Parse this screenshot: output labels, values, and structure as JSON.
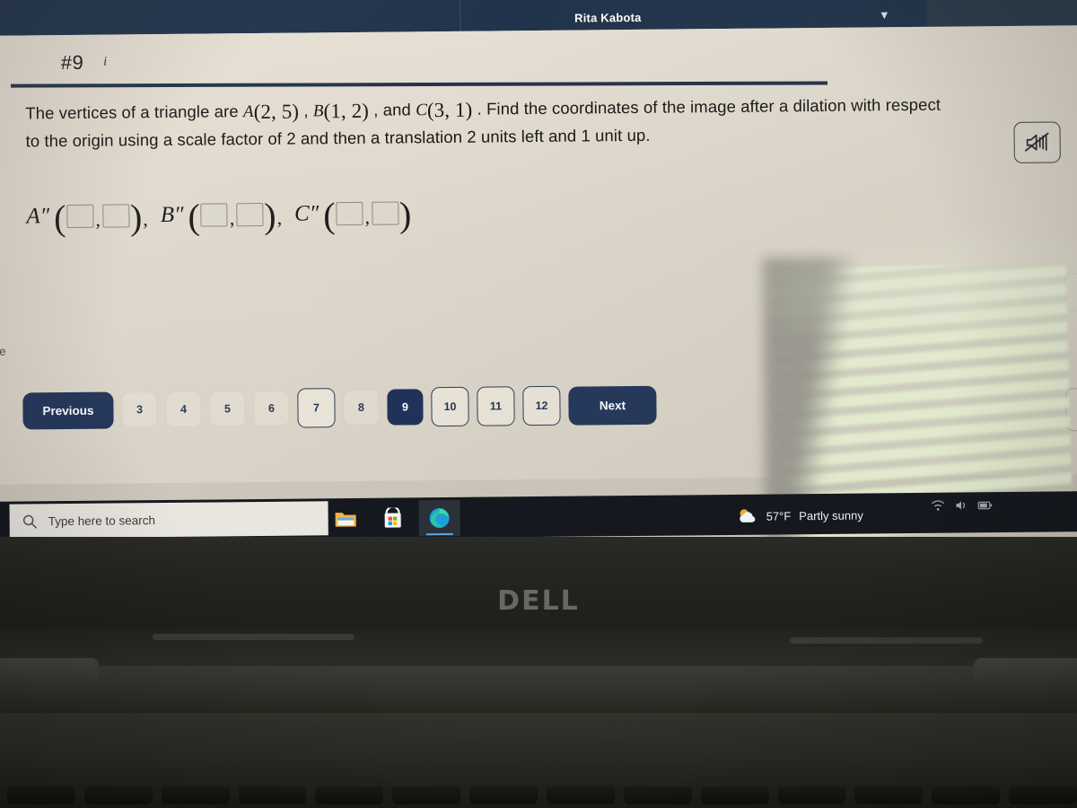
{
  "app": {
    "header": {
      "user_name": "Rita Kabota",
      "caret_icon": "chevron-down-icon"
    },
    "question": {
      "number_label": "#9",
      "info_icon_label": "i",
      "line1_pre": "The vertices of a triangle are ",
      "vertex_a_label": "A",
      "vertex_a_coords": "(2, 5)",
      "sep1": " , ",
      "vertex_b_label": "B",
      "vertex_b_coords": "(1, 2)",
      "sep2": " , and ",
      "vertex_c_label": "C",
      "vertex_c_coords": "(3, 1)",
      "line1_post": " . Find the coordinates of the image after a dilation with respect",
      "line2": "to the origin using a scale factor of 2 and then a translation 2 units left and 1 unit up."
    },
    "answer": {
      "groups": [
        {
          "label": "A″",
          "x_value": "",
          "y_value": ""
        },
        {
          "label": "B″",
          "x_value": "",
          "y_value": ""
        },
        {
          "label": "C″",
          "x_value": "",
          "y_value": ""
        }
      ],
      "separator": ",",
      "open_paren": "(",
      "close_paren": ")",
      "box_placeholder": ""
    },
    "mute_button": {
      "icon": "speaker-muted-icon",
      "state": "muted"
    },
    "pagination": {
      "previous_label": "Previous",
      "next_label": "Next",
      "pages": [
        {
          "label": "3",
          "style": "faded"
        },
        {
          "label": "4",
          "style": "faded"
        },
        {
          "label": "5",
          "style": "faded"
        },
        {
          "label": "6",
          "style": "faded"
        },
        {
          "label": "7",
          "style": "outlined"
        },
        {
          "label": "8",
          "style": "faded"
        },
        {
          "label": "9",
          "style": "active"
        },
        {
          "label": "10",
          "style": "outlined"
        },
        {
          "label": "11",
          "style": "outlined"
        },
        {
          "label": "12",
          "style": "outlined"
        }
      ],
      "active_page": "9"
    },
    "edge_text": "re"
  },
  "taskbar": {
    "search_placeholder": "Type here to search",
    "search_icon": "search-icon",
    "apps": [
      {
        "name": "file-explorer",
        "active": false
      },
      {
        "name": "microsoft-store",
        "active": false
      },
      {
        "name": "microsoft-edge",
        "active": true
      }
    ],
    "weather": {
      "icon": "partly-sunny-icon",
      "temperature": "57°F",
      "condition": "Partly sunny"
    }
  },
  "laptop": {
    "brand": "DELL"
  },
  "colors": {
    "header_navy": "#21344c",
    "accent_navy": "#23365a",
    "page_beige": "#e2dbcf",
    "taskbar_dark": "#15191f",
    "glare_green": "#ecf4d6"
  }
}
